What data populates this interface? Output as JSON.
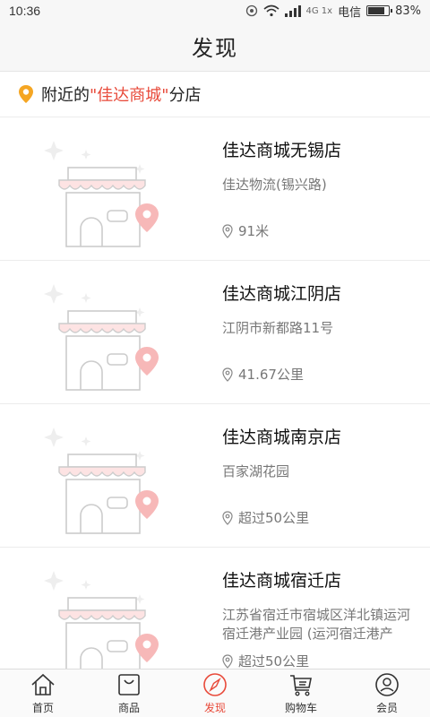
{
  "status": {
    "time": "10:36",
    "net_mini": "4G\n1x",
    "carrier": "电信",
    "battery": "83%",
    "battery_level": 0.83
  },
  "header": {
    "title": "发现"
  },
  "nearby": {
    "prefix": "附近的",
    "brand": "\"佳达商城\"",
    "suffix": "分店"
  },
  "stores": [
    {
      "name": "佳达商城无锡店",
      "address": "佳达物流(锡兴路)",
      "distance": "91米"
    },
    {
      "name": "佳达商城江阴店",
      "address": "江阴市新都路11号",
      "distance": "41.67公里"
    },
    {
      "name": "佳达商城南京店",
      "address": "百家湖花园",
      "distance": "超过50公里"
    },
    {
      "name": "佳达商城宿迁店",
      "address": "江苏省宿迁市宿城区洋北镇运河宿迁港产业园 (运河宿迁港产",
      "distance": "超过50公里"
    }
  ],
  "tabs": [
    {
      "label": "首页",
      "icon": "home-icon"
    },
    {
      "label": "商品",
      "icon": "bag-icon"
    },
    {
      "label": "发现",
      "icon": "compass-icon",
      "active": true
    },
    {
      "label": "购物车",
      "icon": "cart-icon"
    },
    {
      "label": "会员",
      "icon": "user-icon"
    }
  ],
  "colors": {
    "accent": "#e84a3a",
    "pin": "#f5a623"
  }
}
